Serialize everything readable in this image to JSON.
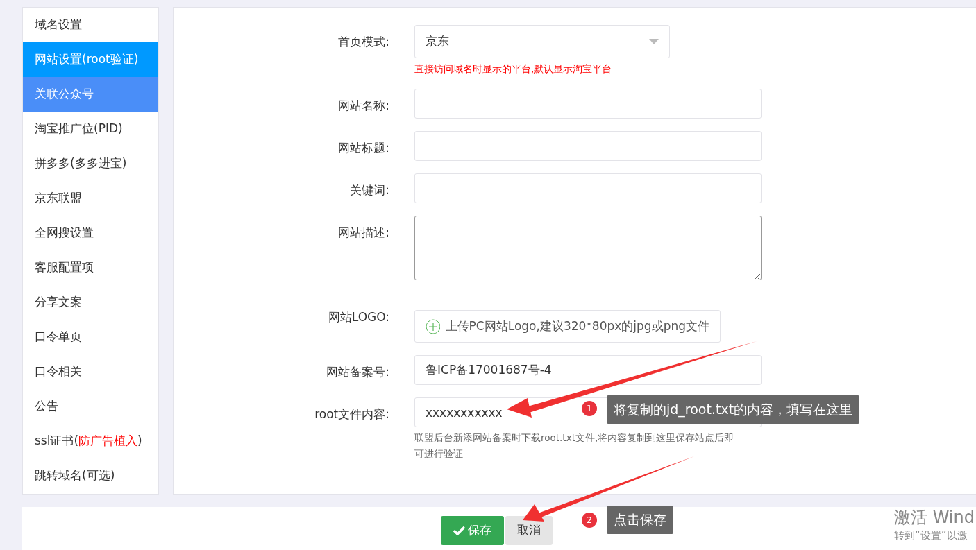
{
  "sidebar": {
    "items": [
      {
        "label_parts": [
          {
            "text": "域名设置",
            "kind": "plain"
          }
        ],
        "selected": false,
        "hovered": false
      },
      {
        "label_parts": [
          {
            "text": "网站设置(root验证)",
            "kind": "plain"
          }
        ],
        "selected": true,
        "hovered": false
      },
      {
        "label_parts": [
          {
            "text": "关联公众号",
            "kind": "plain"
          }
        ],
        "selected": false,
        "hovered": true
      },
      {
        "label_parts": [
          {
            "text": "淘宝推广位(PID)",
            "kind": "plain"
          }
        ],
        "selected": false,
        "hovered": false
      },
      {
        "label_parts": [
          {
            "text": "拼多多(多多进宝)",
            "kind": "plain"
          }
        ],
        "selected": false,
        "hovered": false
      },
      {
        "label_parts": [
          {
            "text": "京东联盟",
            "kind": "plain"
          }
        ],
        "selected": false,
        "hovered": false
      },
      {
        "label_parts": [
          {
            "text": "全网搜设置",
            "kind": "plain"
          }
        ],
        "selected": false,
        "hovered": false
      },
      {
        "label_parts": [
          {
            "text": "客服配置项",
            "kind": "plain"
          }
        ],
        "selected": false,
        "hovered": false
      },
      {
        "label_parts": [
          {
            "text": "分享文案",
            "kind": "plain"
          }
        ],
        "selected": false,
        "hovered": false
      },
      {
        "label_parts": [
          {
            "text": "口令单页",
            "kind": "plain"
          }
        ],
        "selected": false,
        "hovered": false
      },
      {
        "label_parts": [
          {
            "text": "口令相关",
            "kind": "plain"
          }
        ],
        "selected": false,
        "hovered": false
      },
      {
        "label_parts": [
          {
            "text": "公告",
            "kind": "plain"
          }
        ],
        "selected": false,
        "hovered": false
      },
      {
        "label_parts": [
          {
            "text": "ssl证书(",
            "kind": "plain"
          },
          {
            "text": "防广告植入",
            "kind": "warning"
          },
          {
            "text": ")",
            "kind": "plain"
          }
        ],
        "selected": false,
        "hovered": false
      },
      {
        "label_parts": [
          {
            "text": "跳转域名(可选)",
            "kind": "plain"
          }
        ],
        "selected": false,
        "hovered": false
      }
    ]
  },
  "form": {
    "fields": [
      {
        "kind": "select",
        "label": "首页模式:",
        "value": "京东",
        "hint": "直接访问域名时显示的平台,默认显示淘宝平台",
        "hint_warning": true
      },
      {
        "kind": "text",
        "label": "网站名称:"
      },
      {
        "kind": "text",
        "label": "网站标题:"
      },
      {
        "kind": "text",
        "label": "关键词:"
      },
      {
        "kind": "textarea",
        "label": "网站描述:"
      },
      {
        "kind": "upload",
        "label": "网站LOGO:",
        "value": "上传PC网站Logo,建议320*80px的jpg或png文件"
      },
      {
        "kind": "text",
        "label": "网站备案号:",
        "value": "鲁ICP备17001687号-4"
      },
      {
        "kind": "text",
        "label": "root文件内容:",
        "value": "xxxxxxxxxxx",
        "hint": "联盟后台新添网站备案时下载root.txt文件,将内容复制到这里保存站点后即可进行验证",
        "hint_warning": false
      }
    ]
  },
  "footer": {
    "buttons": [
      {
        "label": "保存",
        "kind": "primary"
      },
      {
        "label": "取消",
        "kind": "secondary"
      }
    ]
  },
  "annotations": [
    {
      "number": "1",
      "text": "将复制的jd_root.txt的内容，填写在这里"
    },
    {
      "number": "2",
      "text": "点击保存"
    }
  ],
  "os_notice": {
    "title": "激活 Wind",
    "subtitle": "转到“设置”以激"
  }
}
